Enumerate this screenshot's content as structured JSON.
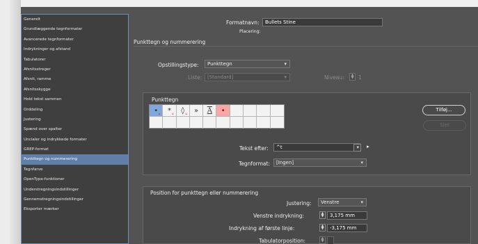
{
  "sidebar": {
    "items": [
      "Generelt",
      "Grundlæggende tegnformater",
      "Avancerede tegnformater",
      "Indrykninger og afstand",
      "Tabulatorer",
      "Afsnitsstreger",
      "Afsnit, ramme",
      "Afsnitsskygge",
      "Hold tekst sammen",
      "Orddeling",
      "Justering",
      "Spænd over spalter",
      "Uncialer og indrykkede formater",
      "GREP-format",
      "Punkttegn og nummerering",
      "Tegnfarve",
      "OpenType-funktioner",
      "Understregningsindstillinger",
      "Gennemstregningsindstillinger",
      "Eksporter mærker"
    ],
    "selected_index": 14
  },
  "header": {
    "format_name_label": "Formatnavn:",
    "format_name_value": "Bullets Stine",
    "placement_label": "Placering:"
  },
  "section": {
    "title": "Punkttegn og nummerering"
  },
  "list_type": {
    "label": "Opstillingstype:",
    "value": "Punkttegn"
  },
  "list": {
    "label": "Liste:",
    "value": "[Standard]",
    "level_label": "Niveau:",
    "level_value": "1"
  },
  "bullets_panel": {
    "title": "Punkttegn",
    "glyphs": [
      {
        "glyph": "•",
        "sub": "u",
        "state": "selected"
      },
      {
        "glyph": "*",
        "sub": "u",
        "state": "normal"
      },
      {
        "glyph": "◊",
        "sub": "u",
        "state": "normal"
      },
      {
        "glyph": "»",
        "sub": "",
        "state": "normal"
      },
      {
        "glyph": "A",
        "sub": "",
        "state": "normal"
      },
      {
        "glyph": "•",
        "sub": "",
        "state": "highlighted"
      }
    ],
    "add_button": "Tilføj...",
    "delete_button": "Slet"
  },
  "text_after": {
    "label": "Tekst efter:",
    "value": "^t",
    "arrow": "▸"
  },
  "char_format": {
    "label": "Tegnformat:",
    "value": "[Ingen]"
  },
  "position": {
    "title": "Position for punkttegn eller nummerering",
    "alignment_label": "Justering:",
    "alignment_value": "Venstre",
    "left_indent_label": "Venstre indrykning:",
    "left_indent_value": "3,175 mm",
    "first_indent_label": "Indrykning af første linje:",
    "first_indent_value": "-3,175 mm",
    "tab_label": "Tabulatorposition:"
  },
  "icons": {
    "chevron": "chevron-down-icon",
    "spinner": "spinner-icon"
  }
}
